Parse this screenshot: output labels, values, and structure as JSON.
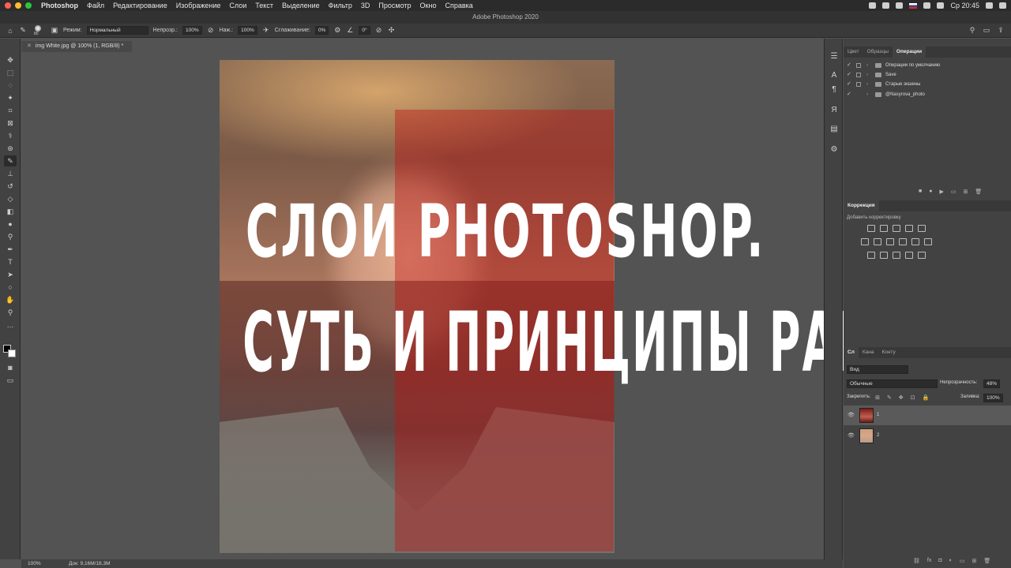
{
  "menubar": {
    "apple_icon": "apple-icon",
    "app": "Photoshop",
    "items": [
      "Файл",
      "Редактирование",
      "Изображение",
      "Слои",
      "Текст",
      "Выделение",
      "Фильтр",
      "3D",
      "Просмотр",
      "Окно",
      "Справка"
    ],
    "clock": "Ср 20:45",
    "traffic_colors": [
      "#fd5f57",
      "#febc2e",
      "#28c840"
    ]
  },
  "window": {
    "title": "Adobe Photoshop 2020"
  },
  "options_bar": {
    "brush_size": "80",
    "mode_label": "Режим:",
    "mode_value": "Нормальный",
    "opacity_label": "Непрозр.:",
    "opacity_value": "100%",
    "pressure_label": "Наж.:",
    "pressure_value": "100%",
    "smoothing_label": "Сглаживание:",
    "smoothing_value": "0%",
    "angle_value": "0°"
  },
  "document": {
    "tab_title": "img White.jpg @ 100% (1, RGB/8) *"
  },
  "overlay": {
    "line1": "СЛОИ PHOTOSHOP.",
    "line2": "СУТЬ И ПРИНЦИПЫ РАБОТЫ"
  },
  "status_bar": {
    "zoom": "100%",
    "doc_info": "Док: 9,16M/18,3M"
  },
  "actions_panel": {
    "tabs": [
      "Цвет",
      "Образцы",
      "Операции"
    ],
    "active_tab": "Операции",
    "items": [
      "Операции по умолчанию",
      "Save",
      "Старые экшены",
      "@Nasyrova_photo"
    ]
  },
  "adjustments_panel": {
    "title": "Коррекция",
    "subtitle": "Добавить корректировку"
  },
  "layers_panel": {
    "tabs": [
      "Сл",
      "Кана",
      "Конту"
    ],
    "kind_value": "Вид",
    "blend_mode": "Обычные",
    "opacity_label": "Непрозрачность:",
    "opacity_value": "48%",
    "lock_label": "Закрепить:",
    "fill_label": "Заливка:",
    "fill_value": "100%",
    "layers": [
      {
        "name": "1",
        "selected": true
      },
      {
        "name": "2",
        "selected": false
      }
    ]
  }
}
